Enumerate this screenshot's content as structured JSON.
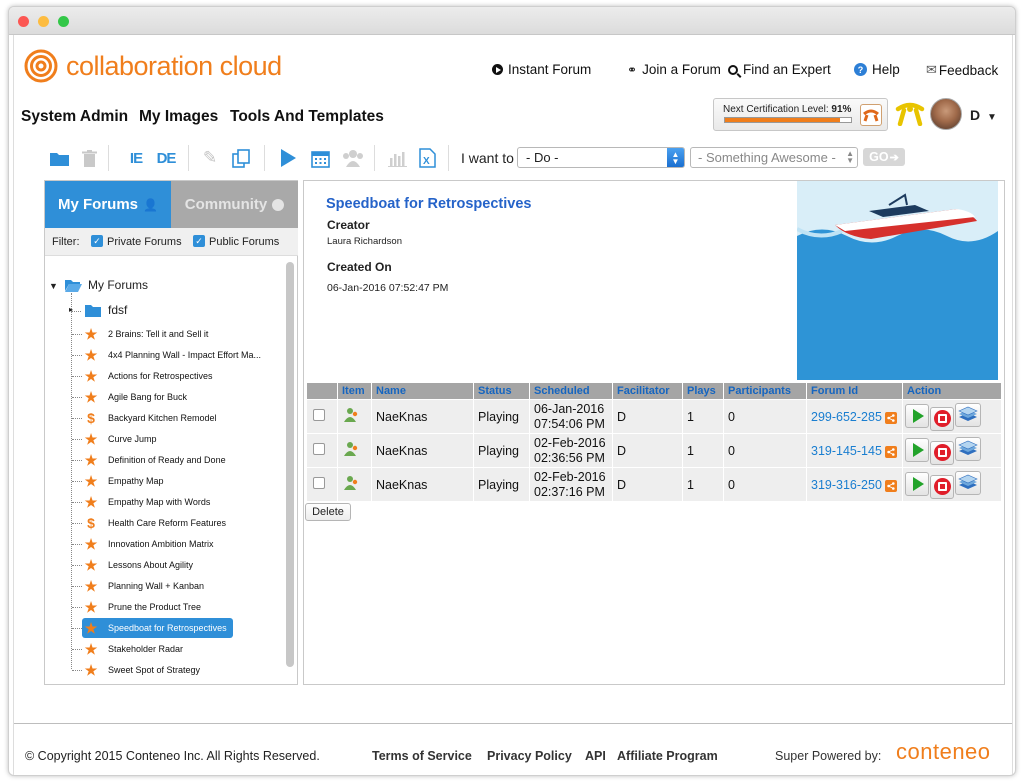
{
  "app": {
    "brand": "collaboration cloud",
    "accent": "#f07e1c"
  },
  "toplinks": {
    "instant": "Instant Forum",
    "join": "Join a Forum",
    "expert": "Find an Expert",
    "help": "Help",
    "feedback": "Feedback"
  },
  "menu": {
    "system_admin": "System Admin",
    "my_images": "My Images",
    "tools": "Tools And Templates"
  },
  "cert": {
    "label": "Next Certification Level:",
    "value": "91%",
    "progress": 0.91
  },
  "user": {
    "initial": "D"
  },
  "toolbar": {
    "ie": "IE",
    "de": "DE",
    "i_want_to": "I want to",
    "do_value": "- Do -",
    "something_value": "- Something Awesome -",
    "go": "GO"
  },
  "tabs": {
    "my_forums": "My Forums",
    "community": "Community"
  },
  "filter": {
    "label": "Filter:",
    "private": "Private Forums",
    "public": "Public Forums"
  },
  "tree": {
    "root": "My Forums",
    "folder": "fdsf",
    "items": [
      {
        "label": "2 Brains: Tell it and Sell it",
        "icon": "star"
      },
      {
        "label": "4x4 Planning Wall - Impact Effort Ma...",
        "icon": "star"
      },
      {
        "label": "Actions for Retrospectives",
        "icon": "star"
      },
      {
        "label": "Agile Bang for Buck",
        "icon": "star"
      },
      {
        "label": "Backyard Kitchen Remodel",
        "icon": "dollar"
      },
      {
        "label": "Curve Jump",
        "icon": "star"
      },
      {
        "label": "Definition of Ready and Done",
        "icon": "star"
      },
      {
        "label": "Empathy Map",
        "icon": "star"
      },
      {
        "label": "Empathy Map with Words",
        "icon": "star"
      },
      {
        "label": "Health Care Reform Features",
        "icon": "dollar"
      },
      {
        "label": "Innovation Ambition Matrix",
        "icon": "star"
      },
      {
        "label": "Lessons About Agility",
        "icon": "star"
      },
      {
        "label": "Planning Wall + Kanban",
        "icon": "star"
      },
      {
        "label": "Prune the Product Tree",
        "icon": "star"
      },
      {
        "label": "Speedboat for Retrospectives",
        "icon": "star",
        "selected": true
      },
      {
        "label": "Stakeholder Radar",
        "icon": "star"
      },
      {
        "label": "Sweet Spot of Strategy",
        "icon": "star"
      }
    ]
  },
  "detail": {
    "title": "Speedboat for Retrospectives",
    "creator_label": "Creator",
    "creator": "Laura Richardson",
    "created_label": "Created On",
    "created": "06-Jan-2016 07:52:47 PM"
  },
  "table": {
    "headers": [
      "Item",
      "Name",
      "Status",
      "Scheduled",
      "Facilitator",
      "Plays",
      "Participants",
      "Forum Id",
      "Action"
    ],
    "rows": [
      {
        "name": "NaeKnas",
        "status": "Playing",
        "date": "06-Jan-2016",
        "time": "07:54:06 PM",
        "facilitator": "D",
        "plays": "1",
        "participants": "0",
        "forum_id": "299-652-285"
      },
      {
        "name": "NaeKnas",
        "status": "Playing",
        "date": "02-Feb-2016",
        "time": "02:36:56 PM",
        "facilitator": "D",
        "plays": "1",
        "participants": "0",
        "forum_id": "319-145-145"
      },
      {
        "name": "NaeKnas",
        "status": "Playing",
        "date": "02-Feb-2016",
        "time": "02:37:16 PM",
        "facilitator": "D",
        "plays": "1",
        "participants": "0",
        "forum_id": "319-316-250"
      }
    ],
    "delete": "Delete"
  },
  "footer": {
    "copyright": "© Copyright 2015 Conteneo Inc. All Rights Reserved.",
    "terms": "Terms of Service",
    "privacy": "Privacy Policy",
    "api": "API",
    "affiliate": "Affiliate Program",
    "powered": "Super Powered by:",
    "powered_brand": "conteneo"
  }
}
